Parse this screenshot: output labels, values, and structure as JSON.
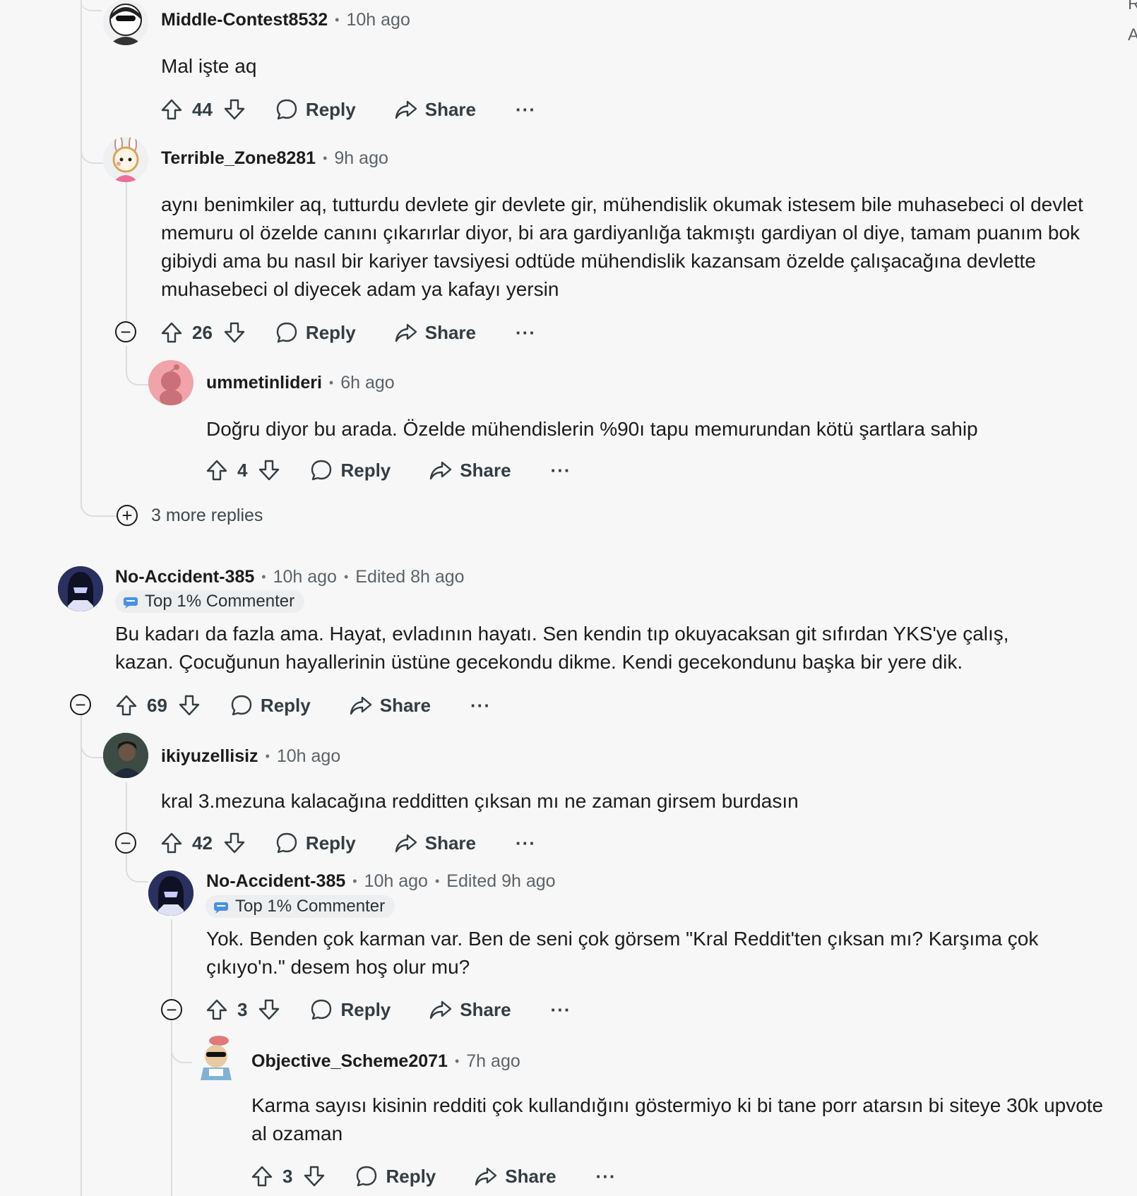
{
  "edge": {
    "r": "R",
    "a": "A"
  },
  "comments": [
    {
      "user": "Middle-Contest8532",
      "time": "10h ago",
      "text": "Mal işte aq",
      "score": "44"
    },
    {
      "user": "Terrible_Zone8281",
      "time": "9h ago",
      "text": "aynı benimkiler aq, tutturdu devlete gir devlete gir, mühendislik okumak istesem bile muhasebeci ol devlet memuru ol özelde canını çıkarırlar diyor, bi ara gardiyanlığa takmıştı gardiyan ol diye, tamam puanım bok gibiydi ama bu nasıl bir kariyer tavsiyesi odtüde mühendislik kazansam özelde çalışacağına devlette muhasebeci ol diyecek adam ya kafayı yersin",
      "score": "26"
    },
    {
      "user": "ummetinlideri",
      "time": "6h ago",
      "text": "Doğru diyor bu arada. Özelde mühendislerin %90ı tapu memurundan kötü şartlara sahip",
      "score": "4"
    },
    {
      "user": "No-Accident-385",
      "time": "10h ago",
      "edited": "Edited 8h ago",
      "badge": "Top 1% Commenter",
      "text": "Bu kadarı da fazla ama. Hayat, evladının hayatı. Sen kendin tıp okuyacaksan git sıfırdan YKS'ye çalış, kazan. Çocuğunun hayallerinin üstüne gecekondu dikme. Kendi gecekondunu başka bir yere dik.",
      "score": "69"
    },
    {
      "user": "ikiyuzellisiz",
      "time": "10h ago",
      "text": "kral 3.mezuna kalacağına redditten çıksan mı ne zaman girsem burdasın",
      "score": "42"
    },
    {
      "user": "No-Accident-385",
      "time": "10h ago",
      "edited": "Edited 9h ago",
      "badge": "Top 1% Commenter",
      "text": "Yok. Benden çok karman var. Ben de seni çok görsem \"Kral Reddit'ten çıksan mı? Karşıma çok çıkıyo'n.\" desem hoş olur mu?",
      "score": "3"
    },
    {
      "user": "Objective_Scheme2071",
      "time": "7h ago",
      "text": "Karma sayısı kisinin redditi çok kullandığını göstermiyo ki bi tane porr atarsın bi siteye 30k upvote al ozaman",
      "score": "3"
    }
  ],
  "more_replies": "3 more replies",
  "labels": {
    "reply": "Reply",
    "share": "Share",
    "more": "···"
  },
  "colors": {
    "background": "#f7f7f7",
    "thread_line": "#d9dde0",
    "text": "#1c1c1c",
    "muted": "#5c6368"
  }
}
